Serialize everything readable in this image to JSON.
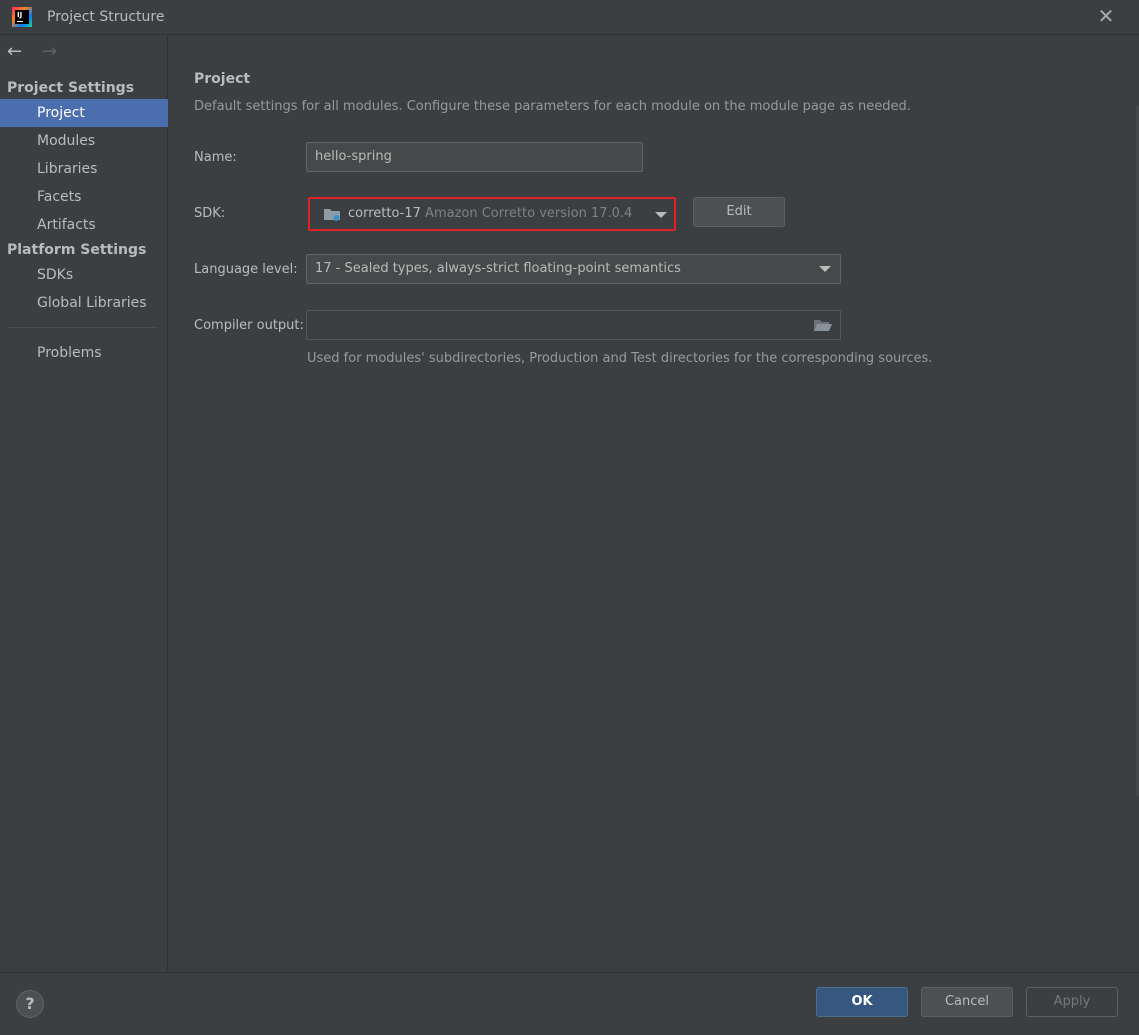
{
  "window": {
    "title": "Project Structure",
    "app_icon": "intellij-idea-icon",
    "close_icon": "close-icon"
  },
  "sidebar": {
    "back_icon": "arrow-left-icon",
    "forward_icon": "arrow-right-icon",
    "project_settings_header": "Project Settings",
    "project_settings_items": [
      "Project",
      "Modules",
      "Libraries",
      "Facets",
      "Artifacts"
    ],
    "platform_settings_header": "Platform Settings",
    "platform_settings_items": [
      "SDKs",
      "Global Libraries"
    ],
    "problems_item": "Problems",
    "selected": "Project"
  },
  "main": {
    "title": "Project",
    "description": "Default settings for all modules. Configure these parameters for each module on the module page as needed.",
    "name_label": "Name:",
    "name_value": "hello-spring",
    "sdk_label": "SDK:",
    "sdk_name": "corretto-17",
    "sdk_version": "Amazon Corretto version 17.0.4",
    "sdk_icon": "folder-jdk-icon",
    "edit_button": "Edit",
    "language_level_label": "Language level:",
    "language_level_value": "17 - Sealed types, always-strict floating-point semantics",
    "compiler_output_label": "Compiler output:",
    "compiler_output_value": "",
    "compiler_output_hint": "Used for modules' subdirectories, Production and Test directories for the corresponding sources.",
    "browse_icon": "folder-open-icon"
  },
  "footer": {
    "help_label": "?",
    "ok_button": "OK",
    "cancel_button": "Cancel",
    "apply_button": "Apply"
  },
  "colors": {
    "background": "#3c3f41",
    "selection": "#4b6eaf",
    "highlight_border": "#e22126",
    "primary_button": "#365880"
  }
}
